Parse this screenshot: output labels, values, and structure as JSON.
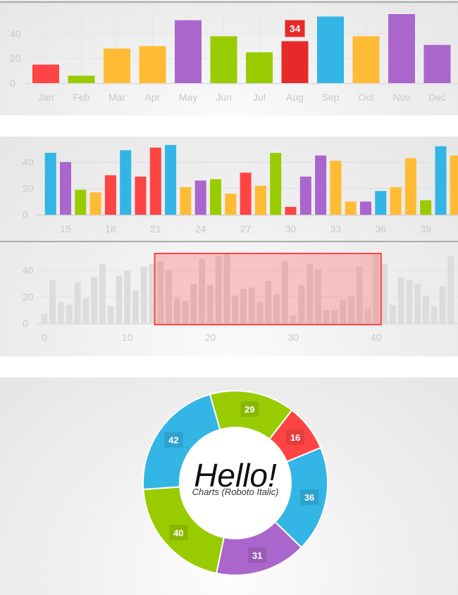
{
  "colors": {
    "red": "#ff4444",
    "dark_red": "#e62a2a",
    "green": "#99cc00",
    "orange": "#ffbb33",
    "purple": "#aa66cc",
    "blue": "#33b5e5",
    "navigator_bar": "#dcdcdc",
    "selection": "#ff4444"
  },
  "chart_data": [
    {
      "type": "bar",
      "title": "",
      "categories": [
        "Jan",
        "Feb",
        "Mar",
        "Apr",
        "May",
        "Jun",
        "Jul",
        "Aug",
        "Sep",
        "Oct",
        "Nov",
        "Dec"
      ],
      "values": [
        15,
        6,
        28,
        30,
        51,
        38,
        25,
        34,
        54,
        38,
        56,
        31
      ],
      "bar_colors": [
        "red",
        "green",
        "orange",
        "orange",
        "purple",
        "green",
        "green",
        "dark_red",
        "blue",
        "orange",
        "purple",
        "purple"
      ],
      "highlighted": {
        "index": 7,
        "label": "34"
      },
      "yticks": [
        "0",
        "20",
        "40"
      ],
      "ylim": [
        0,
        60
      ],
      "grid": true
    },
    {
      "type": "bar",
      "title": "",
      "x_start": 14,
      "values": [
        47,
        40,
        19,
        17,
        30,
        49,
        29,
        51,
        53,
        21,
        26,
        27,
        16,
        32,
        22,
        47,
        6,
        29,
        45,
        41,
        10,
        10,
        18,
        21,
        43,
        11,
        52,
        45
      ],
      "bar_colors": [
        "blue",
        "purple",
        "green",
        "orange",
        "red",
        "blue",
        "red",
        "red",
        "blue",
        "orange",
        "purple",
        "green",
        "orange",
        "red",
        "orange",
        "green",
        "red",
        "purple",
        "purple",
        "orange",
        "orange",
        "purple",
        "blue",
        "orange",
        "orange",
        "green",
        "blue",
        "orange"
      ],
      "xticks": [
        "15",
        "18",
        "21",
        "24",
        "27",
        "30",
        "33",
        "36",
        "39"
      ],
      "yticks": [
        "0",
        "20",
        "40"
      ],
      "xlim": [
        13.3,
        40.6
      ],
      "ylim": [
        0,
        55
      ],
      "grid": true
    },
    {
      "type": "bar",
      "title": "",
      "role": "navigator",
      "values": [
        7,
        33,
        16,
        14,
        31,
        19,
        35,
        45,
        13,
        36,
        40,
        25,
        43,
        45,
        47,
        40,
        19,
        17,
        30,
        49,
        29,
        51,
        53,
        21,
        26,
        27,
        16,
        32,
        22,
        47,
        6,
        29,
        45,
        41,
        10,
        10,
        18,
        21,
        43,
        11,
        52,
        45,
        14,
        35,
        33,
        30,
        21,
        13,
        28,
        51
      ],
      "xticks": [
        "0",
        "10",
        "20",
        "30",
        "40"
      ],
      "yticks": [
        "0",
        "20",
        "40"
      ],
      "selection_range": [
        13.3,
        40.6
      ],
      "ylim": [
        0,
        55
      ],
      "grid": true
    },
    {
      "type": "pie",
      "donut": true,
      "center_title": "Hello!",
      "center_subtitle": "Charts (Roboto Italic)",
      "slices": [
        {
          "label": "29",
          "value": 29,
          "color": "green"
        },
        {
          "label": "16",
          "value": 16,
          "color": "red"
        },
        {
          "label": "36",
          "value": 36,
          "color": "blue"
        },
        {
          "label": "31",
          "value": 31,
          "color": "purple"
        },
        {
          "label": "40",
          "value": 40,
          "color": "green"
        },
        {
          "label": "42",
          "value": 42,
          "color": "blue"
        }
      ],
      "start_angle_deg": -16
    }
  ]
}
